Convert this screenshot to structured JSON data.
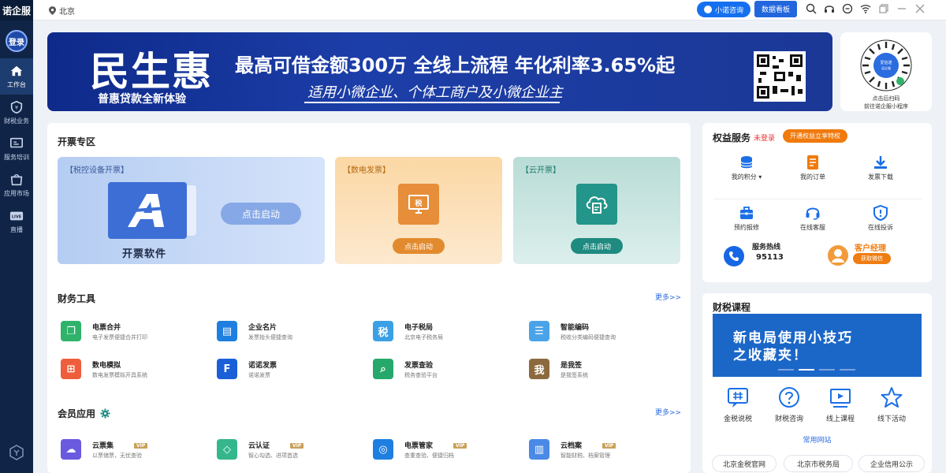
{
  "app": {
    "brand": "诺企服",
    "login": "登录"
  },
  "sidebar": {
    "items": [
      {
        "label": "工作台",
        "icon": "home-icon",
        "active": true
      },
      {
        "label": "财税业务",
        "icon": "tax-icon"
      },
      {
        "label": "服务培训",
        "icon": "training-icon"
      },
      {
        "label": "应用市场",
        "icon": "store-icon"
      },
      {
        "label": "直播",
        "icon": "live-icon",
        "badge": "LIVE"
      }
    ]
  },
  "topbar": {
    "location": "北京",
    "chat_button": "小诺咨询",
    "board_button": "数据看板"
  },
  "banner": {
    "title": "民生惠",
    "subtitle": "普惠贷款全新体验",
    "headline": "最高可借金额300万 全线上流程 年化利率3.65%起",
    "line2": "适用小微企业、个体工商户及小微企业主"
  },
  "mini_program": {
    "badge": "爱信诺 诺企服",
    "line1": "点击后扫码",
    "line2": "前往诺企服小程序"
  },
  "invoice": {
    "title": "开票专区",
    "cards": [
      {
        "tag": "【税控设备开票】",
        "name": "开票软件",
        "button": "点击启动"
      },
      {
        "tag": "【数电发票】",
        "icon_text": "税",
        "button": "点击启动"
      },
      {
        "tag": "【云开票】",
        "button": "点击启动"
      }
    ]
  },
  "finance_tools": {
    "title": "财务工具",
    "more": "更多>>",
    "items": [
      {
        "name": "电票合并",
        "desc": "电子发票便捷合并打印",
        "color": "#2fb36b",
        "glyph": "❐"
      },
      {
        "name": "企业名片",
        "desc": "发票抬头便捷查询",
        "color": "#1e7fe0",
        "glyph": "▤"
      },
      {
        "name": "电子税局",
        "desc": "北京电子税务局",
        "color": "#3aa0e6",
        "glyph": "税"
      },
      {
        "name": "智能编码",
        "desc": "税收分类编码便捷查询",
        "color": "#4aa3e8",
        "glyph": "☰"
      },
      {
        "name": "数电模拟",
        "desc": "数电发票模拟开具系统",
        "color": "#ef5e3c",
        "glyph": "⊞"
      },
      {
        "name": "诺诺发票",
        "desc": "诺诺发票",
        "color": "#1a5fd8",
        "glyph": "F"
      },
      {
        "name": "发票查验",
        "desc": "税务查验平台",
        "color": "#26a86b",
        "glyph": "⌕"
      },
      {
        "name": "是我签",
        "desc": "是我签系统",
        "color": "#8c6a3e",
        "glyph": "我"
      }
    ]
  },
  "member_apps": {
    "title": "会员应用",
    "more": "更多>>",
    "items": [
      {
        "name": "云票集",
        "desc": "以票储票，无忧查验",
        "vip": "VIP",
        "color": "#6a5ae0",
        "glyph": "☁"
      },
      {
        "name": "云认证",
        "desc": "智心勾选、进项首选",
        "vip": "VIP",
        "color": "#34b78c",
        "glyph": "◇"
      },
      {
        "name": "电票管家",
        "desc": "查重查验、便捷归档",
        "vip": "VIP",
        "color": "#1e7fe0",
        "glyph": "◎"
      },
      {
        "name": "云档案",
        "desc": "智能财税、档案管理",
        "vip": "VIP",
        "color": "#4a8ae6",
        "glyph": "▥"
      }
    ]
  },
  "benefits": {
    "title": "权益服务",
    "status": "未登录",
    "tag": "开通权益立享特权",
    "items": [
      {
        "label": "我的积分 ▾"
      },
      {
        "label": "我的订单"
      },
      {
        "label": "发票下载"
      },
      {
        "label": "预约报修"
      },
      {
        "label": "在线客服"
      },
      {
        "label": "在线投诉"
      }
    ],
    "hotline_label": "服务热线",
    "hotline_number": "95113",
    "manager_label": "客户经理",
    "manager_button": "获取微信"
  },
  "courses": {
    "title": "财税课程",
    "banner_line1": "新电局使用小技巧",
    "banner_line2": "之收藏夹！",
    "items": [
      {
        "label": "金税说税"
      },
      {
        "label": "财税咨询"
      },
      {
        "label": "线上课程"
      },
      {
        "label": "线下活动"
      }
    ],
    "common_title": "常用网站",
    "sites": [
      "北京金税官网",
      "北京市税务局",
      "企业信用公示"
    ]
  },
  "colors": {
    "sidebar": "#0f2446",
    "accent": "#1570ef",
    "orange": "#f07a0c"
  }
}
